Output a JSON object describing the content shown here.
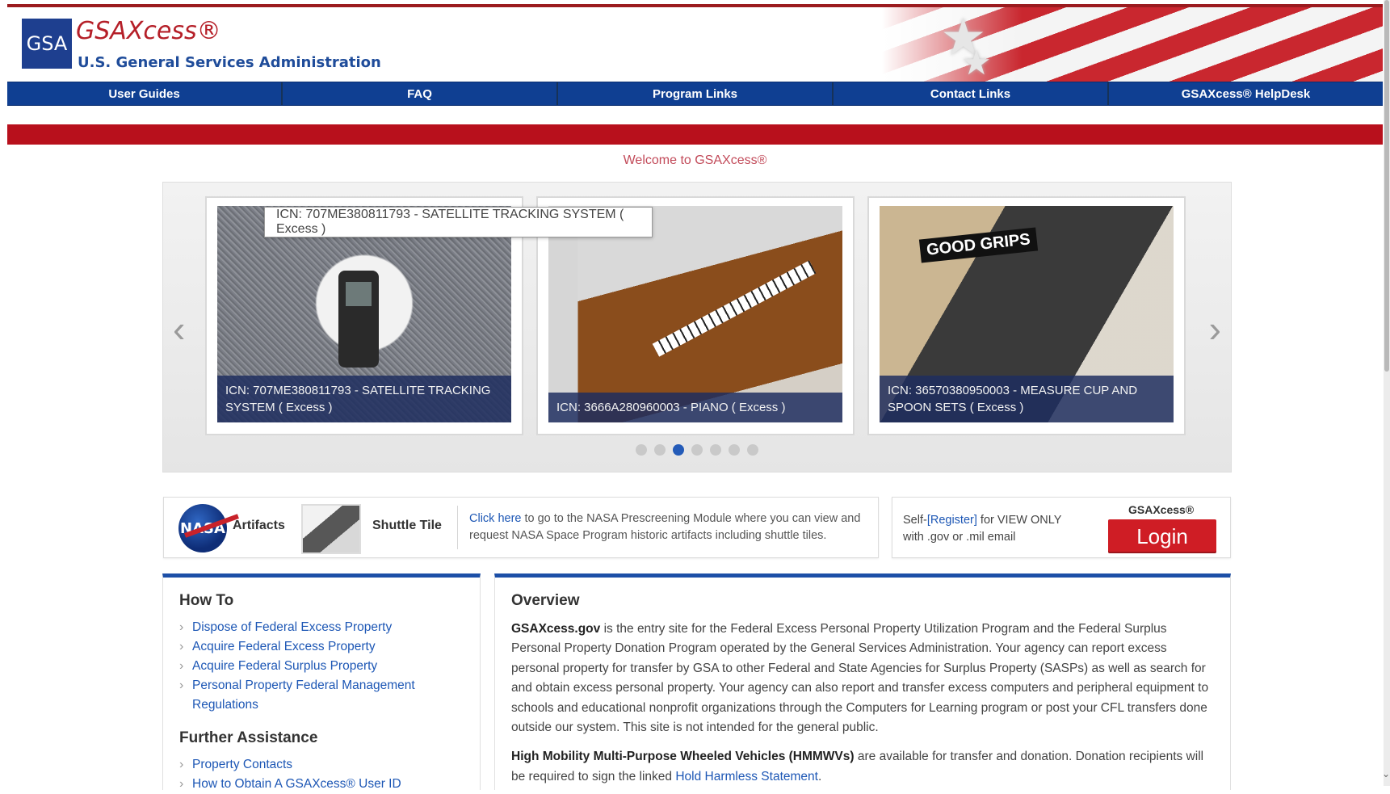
{
  "header": {
    "logo_text": "GSA",
    "brand_title": "GSAXcess®",
    "brand_subtitle": "U.S. General Services Administration"
  },
  "nav": {
    "items": [
      {
        "label": "User Guides"
      },
      {
        "label": "FAQ"
      },
      {
        "label": "Program Links"
      },
      {
        "label": "Contact Links"
      },
      {
        "label": "GSAXcess® HelpDesk"
      }
    ]
  },
  "welcome": "Welcome to GSAXcess®",
  "carousel": {
    "tooltip": "ICN: 707ME380811793 - SATELLITE TRACKING SYSTEM ( Excess )",
    "slides": [
      {
        "caption": "ICN: 707ME380811793 - SATELLITE TRACKING SYSTEM ( Excess )"
      },
      {
        "caption": "ICN: 3666A280960003 - PIANO ( Excess )"
      },
      {
        "caption": "ICN: 36570380950003 - MEASURE CUP AND SPOON SETS ( Excess )"
      }
    ],
    "image_labels": {
      "cups": "GOOD GRIPS"
    },
    "dots_count": 7,
    "active_dot": 3,
    "prev_label": "‹",
    "next_label": "›"
  },
  "nasa": {
    "logo_text": "NASA",
    "artifacts_label": "Artifacts",
    "shuttle_label": "Shuttle Tile",
    "link_text": "Click here",
    "description": " to go to the NASA Prescreening Module where you can view and request NASA Space Program historic artifacts including shuttle tiles."
  },
  "login": {
    "self_prefix": "Self-",
    "register_link": "[Register]",
    "self_suffix": " for VIEW ONLY with .gov or .mil email",
    "brand": "GSAXcess®",
    "button_label": "Login"
  },
  "howto": {
    "title": "How To",
    "links": [
      "Dispose of Federal Excess Property",
      "Acquire Federal Excess Property",
      "Acquire Federal Surplus Property",
      "Personal Property Federal Management Regulations"
    ],
    "further_title": "Further Assistance",
    "further_links": [
      "Property Contacts",
      "How to Obtain A GSAXcess® User ID"
    ]
  },
  "overview": {
    "title": "Overview",
    "p1_bold": "GSAXcess.gov",
    "p1_text": " is the entry site for the Federal Excess Personal Property Utilization Program and the Federal Surplus Personal Property Donation Program operated by the General Services Administration. Your agency can report excess personal property for transfer by GSA to other Federal and State Agencies for Surplus Property (SASPs) as well as search for and obtain excess personal property. Your agency can also report and transfer excess computers and peripheral equipment to schools and educational nonprofit organizations through the Computers for Learning program or post your CFL transfers done outside our system. This site is not intended for the general public.",
    "p2_bold": "High Mobility Multi-Purpose Wheeled Vehicles (HMMWVs)",
    "p2_text": " are available for transfer and donation. Donation recipients will be required to sign the linked ",
    "p2_link": "Hold Harmless Statement",
    "p2_end": "."
  },
  "colors": {
    "nav_blue": "#0f3f92",
    "brand_red": "#b8101c",
    "link_blue": "#1d57b5",
    "login_red": "#cf1d25"
  }
}
